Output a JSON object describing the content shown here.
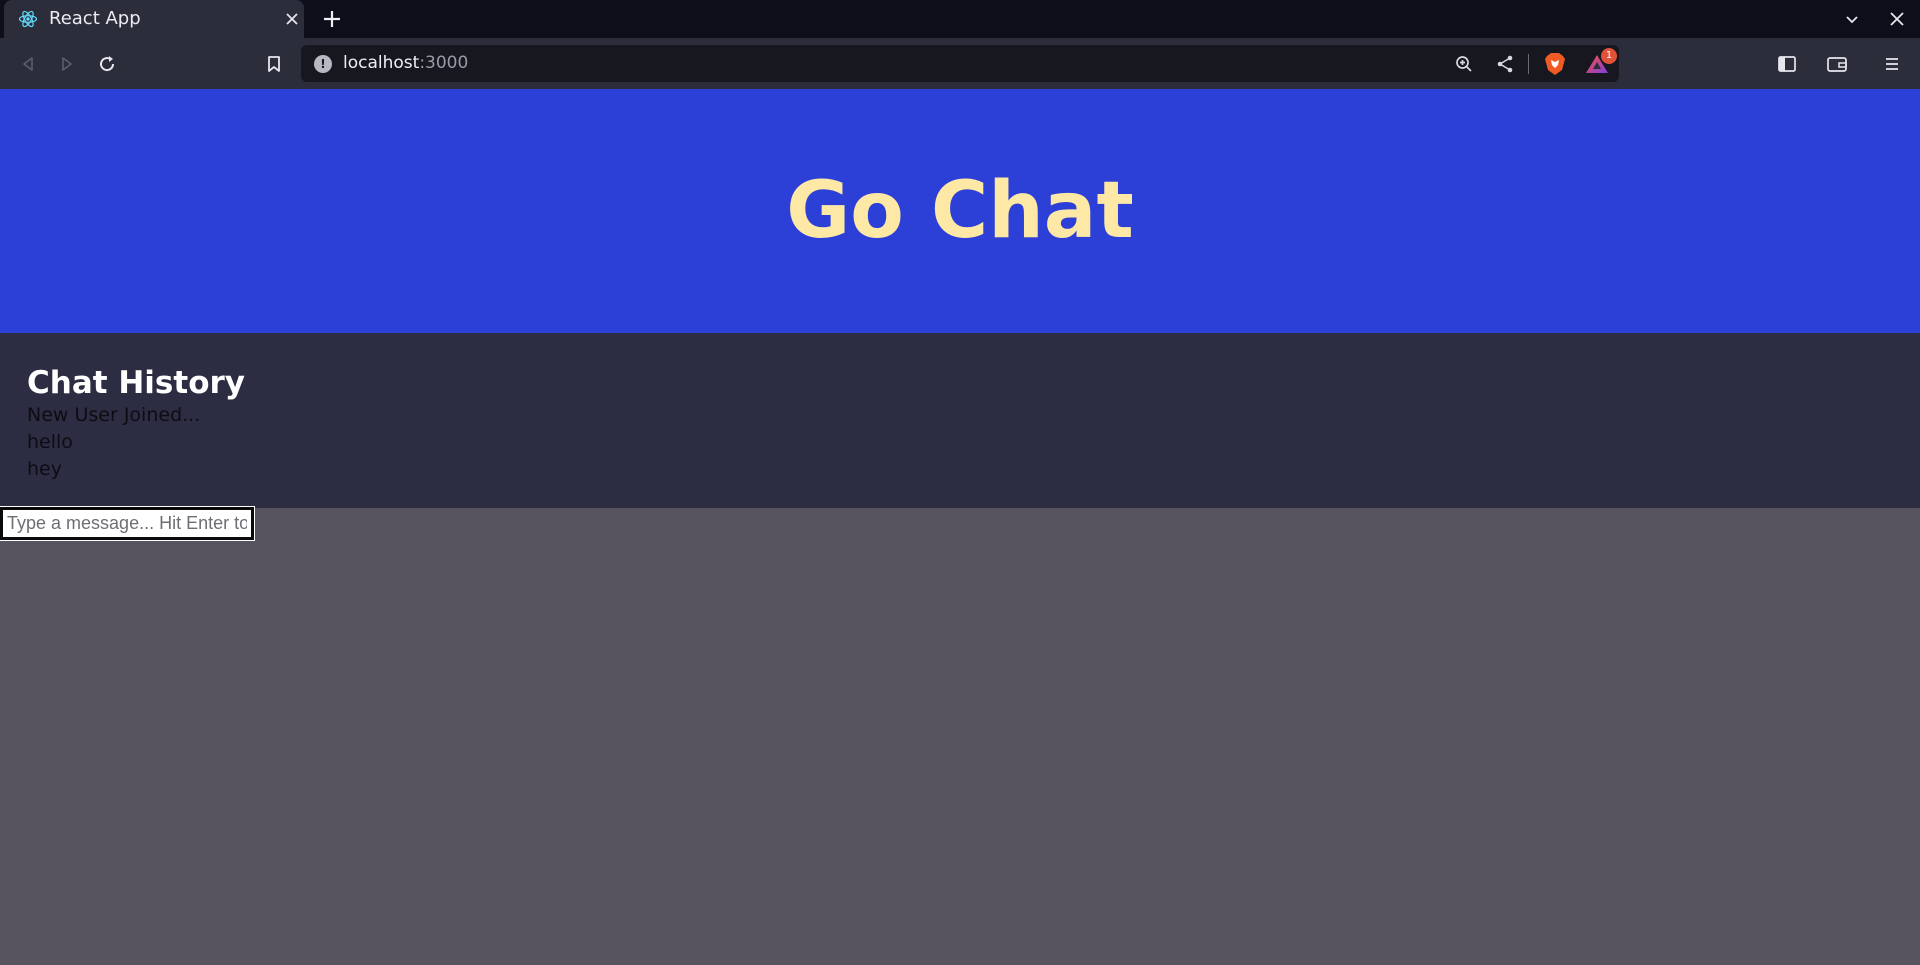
{
  "browser": {
    "tab": {
      "title": "React App",
      "favicon": "react-atom-icon"
    },
    "address_bar": {
      "host": "localhost",
      "port": ":3000"
    },
    "rewards_badge": "1",
    "accent_colors": {
      "brave_shield": "#f05a24",
      "rewards": "#7b3fe4",
      "badge": "#e2513a"
    }
  },
  "page": {
    "header": {
      "title": "Go Chat",
      "background": "#2c3fd6",
      "color": "#fde8a6"
    },
    "chat_history": {
      "title": "Chat History",
      "messages": [
        "New User Joined...",
        "hello",
        "hey"
      ]
    },
    "composer": {
      "placeholder": "Type a message... Hit Enter to Send",
      "value": ""
    }
  }
}
